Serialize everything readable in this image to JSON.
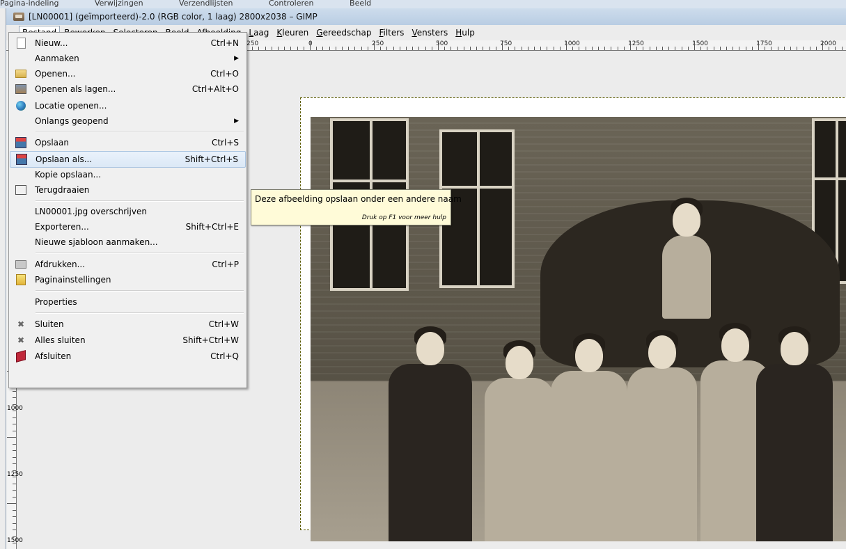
{
  "background_window": {
    "menu_items": [
      "Pagina-indeling",
      "Verwijzingen",
      "Verzendlijsten",
      "Controleren",
      "Beeld"
    ]
  },
  "window": {
    "title": "[LN00001] (geïmporteerd)-2.0 (RGB color, 1 laag) 2800x2038 – GIMP"
  },
  "menubar": {
    "items": [
      "Bestand",
      "Bewerken",
      "Selecteren",
      "Beeld",
      "Afbeelding",
      "Laag",
      "Kleuren",
      "Gereedschap",
      "Filters",
      "Vensters",
      "Hulp"
    ],
    "active": "Bestand"
  },
  "ruler": {
    "h_labels": [
      "250",
      "0",
      "250",
      "500",
      "750",
      "1000",
      "1250",
      "1500",
      "1750",
      "2000"
    ],
    "v_labels": [
      "1000",
      "1250",
      "1500"
    ]
  },
  "file_menu": {
    "items": [
      {
        "label": "Nieuw...",
        "accel": "Ctrl+N",
        "icon": "new-document-icon"
      },
      {
        "label": "Aanmaken",
        "accel": "",
        "submenu": true
      },
      {
        "label": "Openen...",
        "accel": "Ctrl+O",
        "icon": "folder-icon"
      },
      {
        "label": "Openen als lagen...",
        "accel": "Ctrl+Alt+O",
        "icon": "open-layers-icon"
      },
      {
        "label": "Locatie openen...",
        "accel": "",
        "icon": "globe-icon"
      },
      {
        "label": "Onlangs geopend",
        "accel": "",
        "submenu": true
      },
      {
        "label": "Opslaan",
        "accel": "Ctrl+S",
        "icon": "save-icon"
      },
      {
        "label": "Opslaan als...",
        "accel": "Shift+Ctrl+S",
        "icon": "save-as-icon",
        "highlighted": true
      },
      {
        "label": "Kopie opslaan...",
        "accel": ""
      },
      {
        "label": "Terugdraaien",
        "accel": "",
        "icon": "revert-icon"
      },
      {
        "label": "LN00001.jpg overschrijven",
        "accel": ""
      },
      {
        "label": "Exporteren...",
        "accel": "Shift+Ctrl+E"
      },
      {
        "label": "Nieuwe sjabloon aanmaken...",
        "accel": ""
      },
      {
        "label": "Afdrukken...",
        "accel": "Ctrl+P",
        "icon": "print-icon"
      },
      {
        "label": "Paginainstellingen",
        "accel": "",
        "icon": "page-setup-icon"
      },
      {
        "label": "Properties",
        "accel": ""
      },
      {
        "label": "Sluiten",
        "accel": "Ctrl+W",
        "icon": "close-icon"
      },
      {
        "label": "Alles sluiten",
        "accel": "Shift+Ctrl+W",
        "icon": "close-all-icon"
      },
      {
        "label": "Afsluiten",
        "accel": "Ctrl+Q",
        "icon": "quit-icon"
      }
    ]
  },
  "tooltip": {
    "text": "Deze afbeelding opslaan onder een andere naam",
    "hint": "Druk op F1 voor meer hulp"
  }
}
